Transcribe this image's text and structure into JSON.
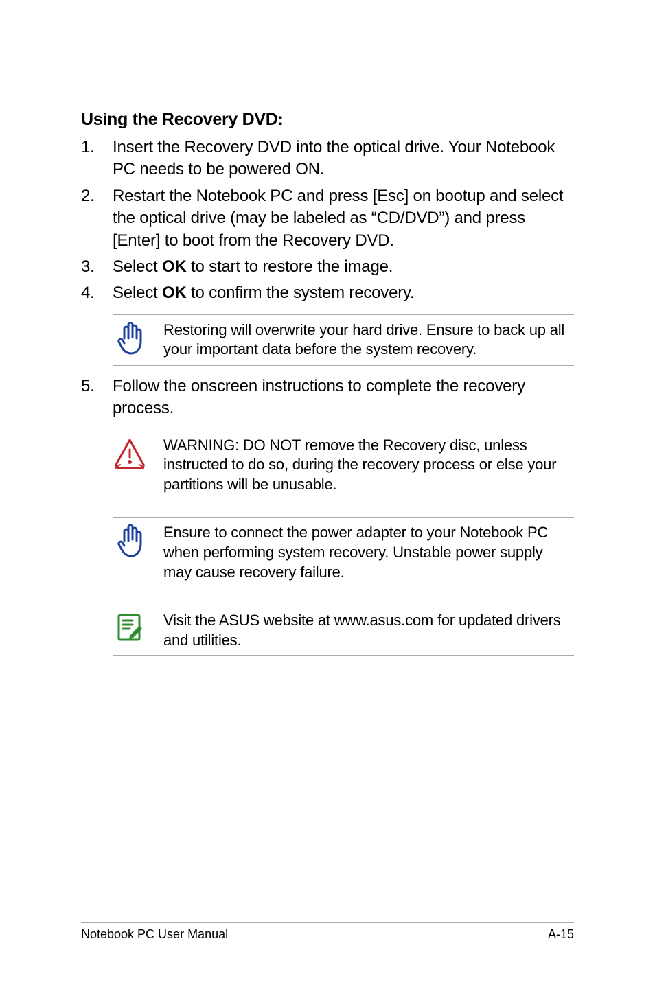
{
  "heading": "Using the Recovery DVD:",
  "steps": [
    {
      "num": "1.",
      "text": "Insert the Recovery DVD into the optical drive. Your Notebook PC needs to be powered ON."
    },
    {
      "num": "2.",
      "text": "Restart the Notebook PC and press [Esc] on bootup and select the optical drive (may be labeled as “CD/DVD”) and press [Enter] to boot from the Recovery DVD."
    },
    {
      "num": "3.",
      "pre": "Select ",
      "bold": "OK",
      "post": " to start to restore the image."
    },
    {
      "num": "4.",
      "pre": "Select ",
      "bold": "OK",
      "post": " to confirm the system recovery."
    },
    {
      "num": "5.",
      "text": "Follow the onscreen instructions to complete the recovery process."
    }
  ],
  "callouts": {
    "important1": "Restoring will overwrite your hard drive. Ensure to back up all your important data before the system recovery.",
    "warning": "WARNING: DO NOT remove the Recovery disc, unless instructed to do so, during the recovery process or else your partitions will be unusable.",
    "important2": "Ensure to connect the power adapter to your Notebook PC when performing system recovery. Unstable power supply may cause recovery failure.",
    "note": "Visit the ASUS website at www.asus.com for updated drivers and utilities."
  },
  "footer": {
    "left": "Notebook PC User Manual",
    "right": "A-15"
  },
  "icons": {
    "hand_color": "#1b3f9b",
    "warning_color": "#c1272d",
    "note_color": "#2e8b2e"
  }
}
